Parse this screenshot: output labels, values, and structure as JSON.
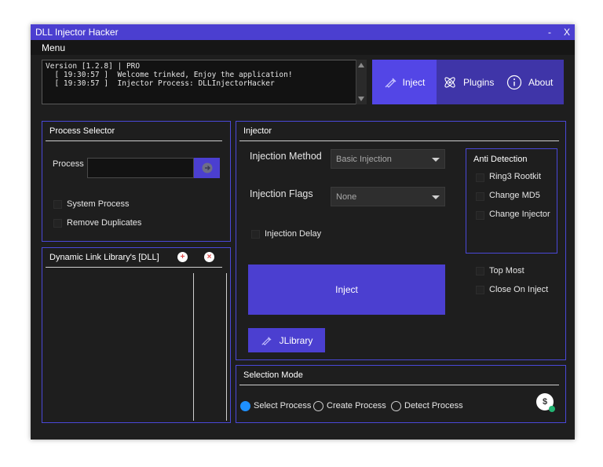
{
  "window": {
    "title": "DLL Injector Hacker",
    "minimize": "-",
    "close": "X"
  },
  "menubar": {
    "menu": "Menu"
  },
  "log": {
    "lines": [
      "Version [1.2.8] | PRO",
      "  [ 19:30:57 ]  Welcome trinked, Enjoy the application!",
      "  [ 19:30:57 ]  Injector Process: DLLInjectorHacker"
    ]
  },
  "nav": {
    "inject": "Inject",
    "plugins": "Plugins",
    "about": "About"
  },
  "process_selector": {
    "title": "Process Selector",
    "process_label": "Process",
    "process_value": "",
    "system_process": "System Process",
    "remove_duplicates": "Remove Duplicates"
  },
  "dll_panel": {
    "title": "Dynamic Link Library's [DLL]",
    "add": "+",
    "remove": "×"
  },
  "injector": {
    "title": "Injector",
    "method_label": "Injection Method",
    "method_value": "Basic Injection",
    "flags_label": "Injection Flags",
    "flags_value": "None",
    "delay": "Injection Delay",
    "inject_button": "Inject",
    "jlibrary_button": "JLibrary",
    "top_most": "Top Most",
    "close_on_inject": "Close On Inject"
  },
  "anti_detection": {
    "title": "Anti Detection",
    "items": [
      "Ring3 Rootkit",
      "Change MD5",
      "Change Injector"
    ]
  },
  "selection_mode": {
    "title": "Selection Mode",
    "options": [
      "Select Process",
      "Create Process",
      "Detect Process"
    ],
    "selected": "Select Process",
    "badge": "$"
  },
  "colors": {
    "accent": "#4b3fd0",
    "nav_active": "#5346e6",
    "radio_on": "#1e90ff",
    "background": "#1e1e1e"
  }
}
